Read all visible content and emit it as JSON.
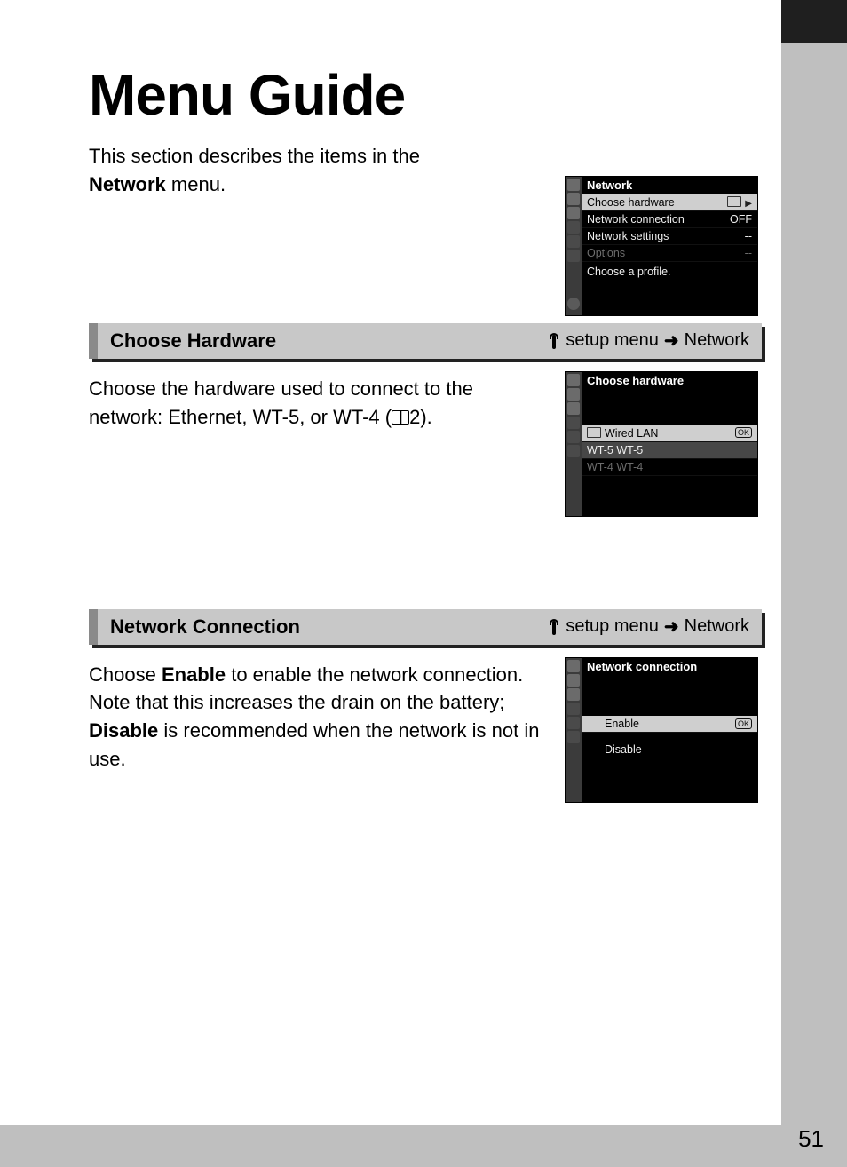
{
  "page": {
    "title": "Menu Guide",
    "intro_pre": "This section describes the items in the ",
    "intro_bold": "Network",
    "intro_post": " menu.",
    "number": "51"
  },
  "breadcrumb": {
    "setup": "setup menu",
    "arrow": "➜",
    "target": "Network"
  },
  "section1": {
    "title": "Choose Hardware",
    "body_pre": "Choose the hardware used to connect to the network: Ethernet, WT-5, or WT-4 (",
    "body_ref": "2",
    "body_post": ")."
  },
  "section2": {
    "title": "Network Connection",
    "body_1": "Choose ",
    "body_b1": "Enable",
    "body_2": " to enable the network connection. Note that this increases the drain on the battery; ",
    "body_b2": "Disable",
    "body_3": " is recommended when the network is not in use."
  },
  "cam1": {
    "header": "Network",
    "rows": [
      {
        "label": "Choose hardware",
        "value": "",
        "sel": true,
        "icon": true,
        "tri": true
      },
      {
        "label": "Network connection",
        "value": "OFF"
      },
      {
        "label": "Network settings",
        "value": "--"
      },
      {
        "label": "Options",
        "value": "--",
        "dim": true
      }
    ],
    "footer": "Choose a profile."
  },
  "cam2": {
    "header": "Choose hardware",
    "rows": [
      {
        "label": "Wired LAN",
        "sel": true,
        "icon": true,
        "ok": true
      },
      {
        "label": "WT-5 WT-5",
        "grey": true
      },
      {
        "label": "WT-4 WT-4",
        "dim": true
      }
    ]
  },
  "cam3": {
    "header": "Network connection",
    "rows": [
      {
        "label": "Enable",
        "sel": true,
        "ok": true
      },
      {
        "label": "Disable"
      }
    ]
  }
}
